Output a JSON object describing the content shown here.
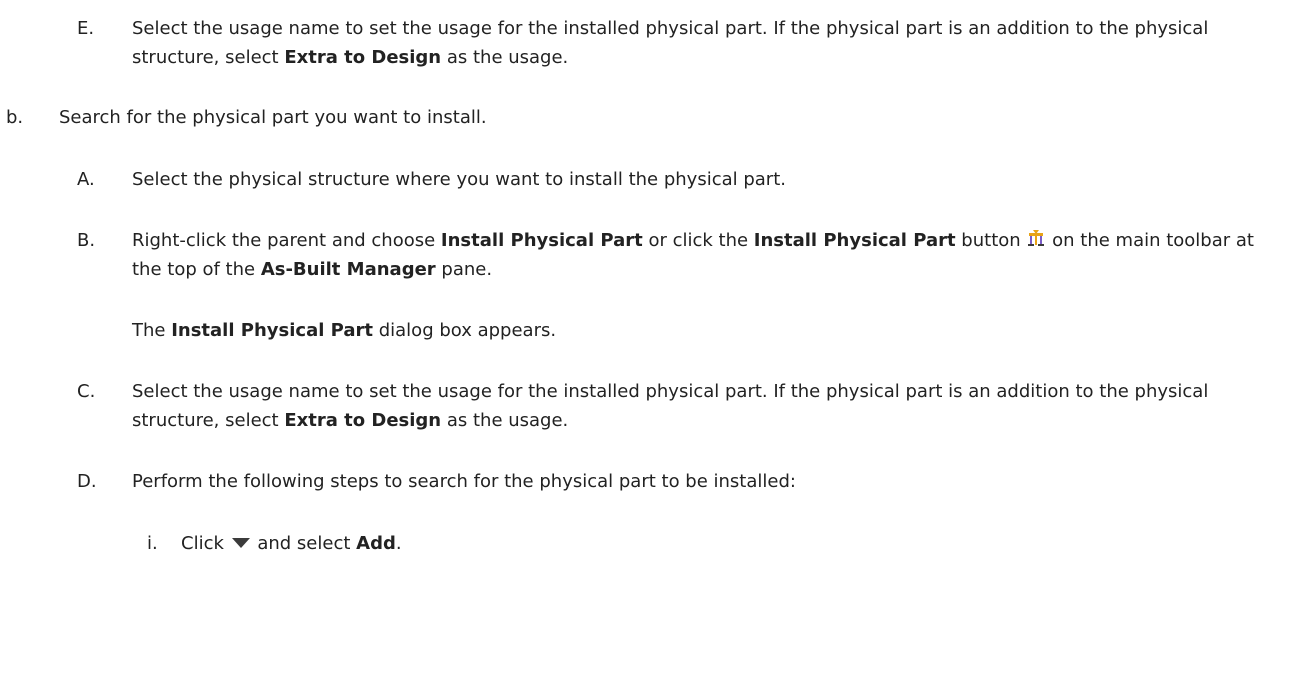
{
  "steps": {
    "E": {
      "marker": "E.",
      "t1": "Select the usage name to set the usage for the installed physical part. If the physical part is an addition to the physical structure, select ",
      "b1": "Extra to Design",
      "t2": " as the usage."
    },
    "b": {
      "marker": "b.",
      "t1": "Search for the physical part you want to install."
    },
    "A": {
      "marker": "A.",
      "t1": "Select the physical structure where you want to install the physical part."
    },
    "B": {
      "marker": "B.",
      "t1": "Right-click the parent and choose ",
      "b1": "Install Physical Part",
      "t2": " or click the ",
      "b2": "Install Physical Part",
      "t3": " button ",
      "t4": " on the main toolbar at the top of the ",
      "b3": "As-Built Manager",
      "t5": " pane."
    },
    "B_note": {
      "t1": "The ",
      "b1": "Install Physical Part",
      "t2": " dialog box appears."
    },
    "C": {
      "marker": "C.",
      "t1": "Select the usage name to set the usage for the installed physical part. If the physical part is an addition to the physical structure, select ",
      "b1": "Extra to Design",
      "t2": " as the usage."
    },
    "D": {
      "marker": "D.",
      "t1": "Perform the following steps to search for the physical part to be installed:"
    },
    "i": {
      "marker": "i.",
      "t1": "Click ",
      "t2": " and select ",
      "b1": "Add",
      "t3": "."
    }
  },
  "icons": {
    "install": "install-physical-part-icon",
    "dropdown": "dropdown-arrow-icon"
  },
  "colors": {
    "text": "#222222",
    "icon_dark": "#3b3b3b",
    "icon_accent": "#e8a317",
    "icon_accent2": "#7a5cc7"
  }
}
